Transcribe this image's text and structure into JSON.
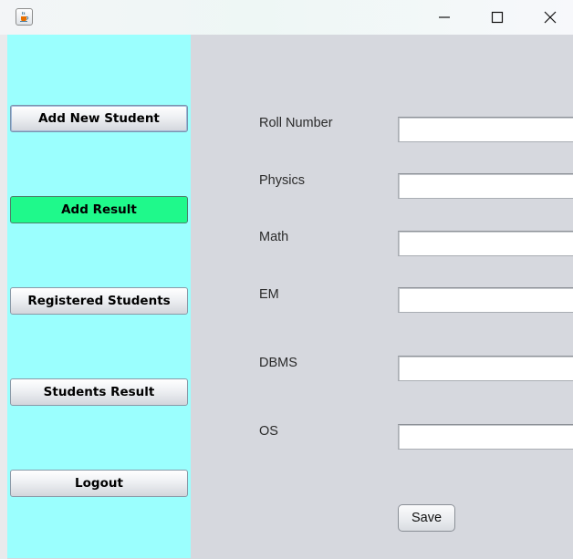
{
  "window": {
    "app_icon": "java-cup-icon",
    "controls": [
      "minimize-icon",
      "maximize-icon",
      "close-icon"
    ]
  },
  "sidebar": {
    "background": "#9bfffe",
    "buttons": [
      {
        "label": "Add New Student",
        "state": "selected"
      },
      {
        "label": "Add Result",
        "state": "active",
        "color": "#1ff98b"
      },
      {
        "label": "Registered Students",
        "state": "normal"
      },
      {
        "label": "Students Result",
        "state": "normal"
      },
      {
        "label": "Logout",
        "state": "normal"
      }
    ]
  },
  "form": {
    "fields": [
      {
        "label": "Roll Number",
        "value": ""
      },
      {
        "label": "Physics",
        "value": ""
      },
      {
        "label": "Math",
        "value": ""
      },
      {
        "label": "EM",
        "value": ""
      },
      {
        "label": "DBMS",
        "value": ""
      },
      {
        "label": "OS",
        "value": ""
      }
    ],
    "save_label": "Save"
  }
}
